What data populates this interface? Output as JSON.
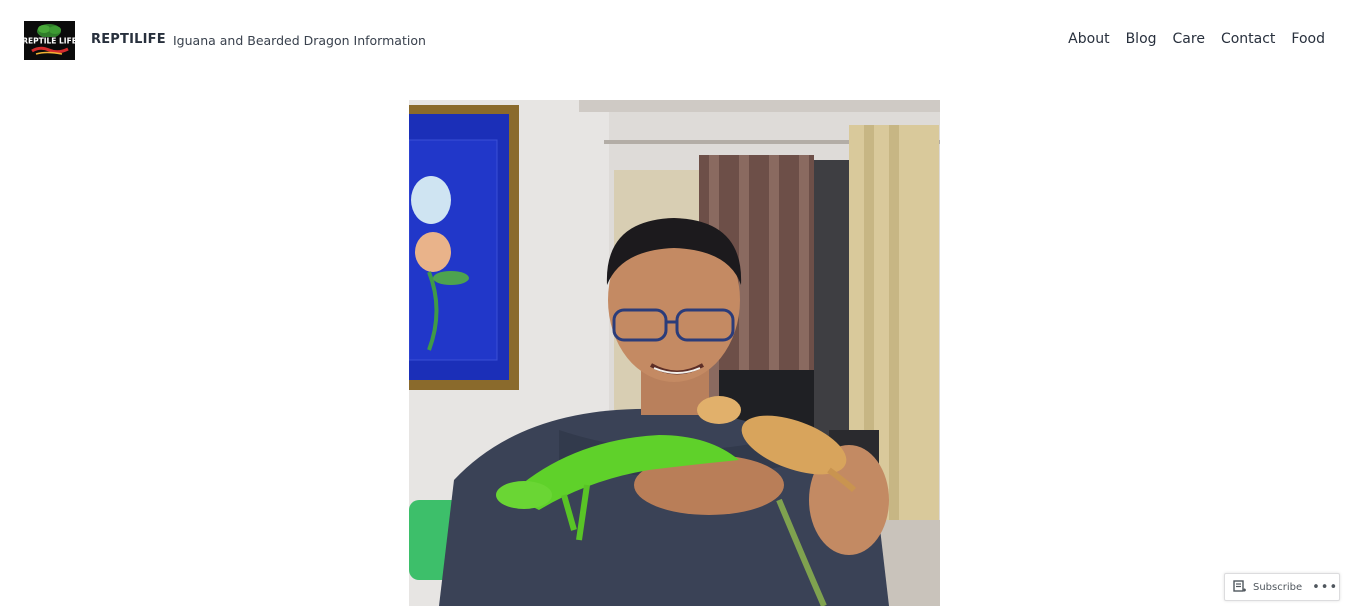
{
  "header": {
    "logo_text": "REPTILE LIFE",
    "site_title": "REPTILIFE",
    "tagline": "Iguana and Bearded Dragon Information"
  },
  "nav": {
    "items": [
      {
        "label": "About"
      },
      {
        "label": "Blog"
      },
      {
        "label": "Care"
      },
      {
        "label": "Contact"
      },
      {
        "label": "Food"
      }
    ]
  },
  "main": {
    "featured_image_icon": "person-holding-iguana-and-bearded-dragon-photo"
  },
  "actionbar": {
    "subscribe_label": "Subscribe",
    "more_label": "•••"
  }
}
